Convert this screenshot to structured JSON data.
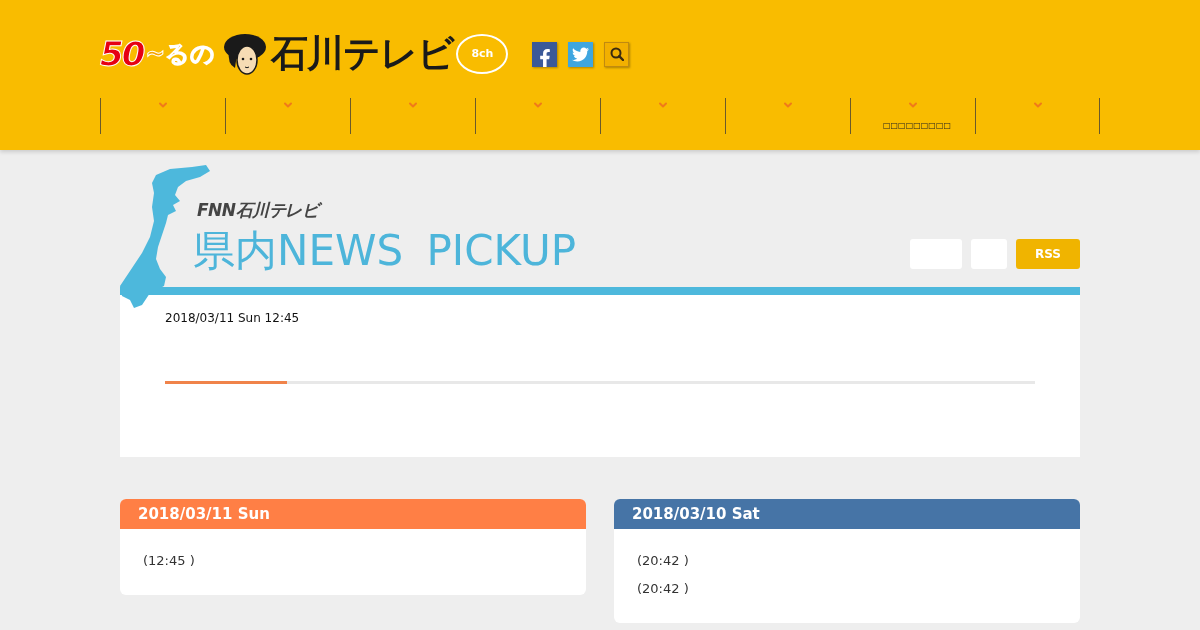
{
  "header": {
    "logo": {
      "number": "50",
      "tagline": "~るの",
      "name": "石川テレビ",
      "channel": "8ch"
    },
    "nav": [
      {
        "kind": "dropdown"
      },
      {
        "kind": "dropdown"
      },
      {
        "kind": "dropdown"
      },
      {
        "kind": "dropdown"
      },
      {
        "kind": "dropdown"
      },
      {
        "kind": "dropdown"
      },
      {
        "kind": "dropdown",
        "label": "□□□□□□□□□"
      },
      {
        "kind": "dropdown"
      }
    ]
  },
  "pickup": {
    "brand": "FNN石川テレビ",
    "title": "県内NEWS PICKUP",
    "buttons": [
      {
        "kind": "wide"
      },
      {
        "kind": "narrow"
      },
      {
        "kind": "rss",
        "label": "RSS"
      }
    ],
    "date": "2018/03/11 Sun 12:45",
    "progress": {
      "level": 0.14
    }
  },
  "days": [
    {
      "date": "2018/03/11 Sun",
      "color": "#ff7f45",
      "items": [
        "(12:45 )"
      ]
    },
    {
      "date": "2018/03/10 Sat",
      "color": "#4674a6",
      "items": [
        "(20:42 )",
        "(20:42 )"
      ]
    }
  ]
}
